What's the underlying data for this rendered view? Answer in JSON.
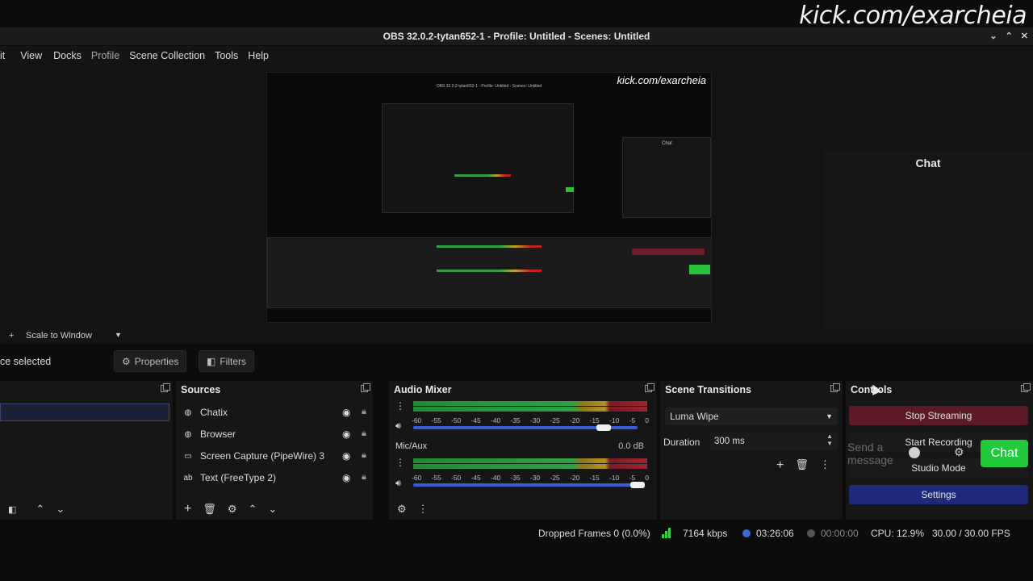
{
  "watermark": "kick.com/exarcheia",
  "window": {
    "title": "OBS 32.0.2-tytan652-1 - Profile: Untitled - Scenes: Untitled"
  },
  "menu": [
    "it",
    "View",
    "Docks",
    "Profile",
    "Scene Collection",
    "Tools",
    "Help"
  ],
  "preview": {
    "watermark": "kick.com/exarcheia",
    "title": "OBS 32.0.2-tytan652-1 - Profile: Untitled - Scenes: Untitled",
    "chat_label": "Chat"
  },
  "chat_dock": {
    "title": "Chat"
  },
  "context_bar": {
    "scale": "Scale to Window"
  },
  "source_toolbar": {
    "none_selected": "ce selected",
    "properties": "Properties",
    "filters": "Filters"
  },
  "sources": {
    "title": "Sources",
    "items": [
      {
        "name": "Chatix",
        "icon": "globe-icon"
      },
      {
        "name": "Browser",
        "icon": "globe-icon"
      },
      {
        "name": "Screen Capture (PipeWire) 3",
        "icon": "monitor-icon"
      },
      {
        "name": "Text (FreeType 2)",
        "icon": "text-icon"
      }
    ]
  },
  "mixer": {
    "title": "Audio Mixer",
    "scale": [
      "-60",
      "-55",
      "-50",
      "-45",
      "-40",
      "-35",
      "-30",
      "-25",
      "-20",
      "-15",
      "-10",
      "-5",
      "0"
    ],
    "channels": [
      {
        "name": "",
        "db": "",
        "volume": 0.85
      },
      {
        "name": "Mic/Aux",
        "db": "0.0 dB",
        "volume": 1.0
      }
    ]
  },
  "transitions": {
    "title": "Scene Transitions",
    "selected": "Luma Wipe",
    "duration_label": "Duration",
    "duration_value": "300 ms"
  },
  "controls": {
    "title": "Controls",
    "stop_streaming": "Stop Streaming",
    "start_recording": "Start Recording",
    "studio_mode": "Studio Mode",
    "settings": "Settings"
  },
  "chat_overlay": {
    "placeholder": "Send a message",
    "send_button": "Chat"
  },
  "status": {
    "dropped_frames": "Dropped Frames 0 (0.0%)",
    "bitrate": "7164 kbps",
    "live_time": "03:26:06",
    "rec_time": "00:00:00",
    "cpu": "CPU: 12.9%",
    "fps": "30.00 / 30.00 FPS"
  },
  "colors": {
    "stop_streaming": "#5b1a26",
    "settings": "#1d2a7a",
    "chat_button": "#22c93a",
    "bitrate_signal": "#2fd04a"
  }
}
